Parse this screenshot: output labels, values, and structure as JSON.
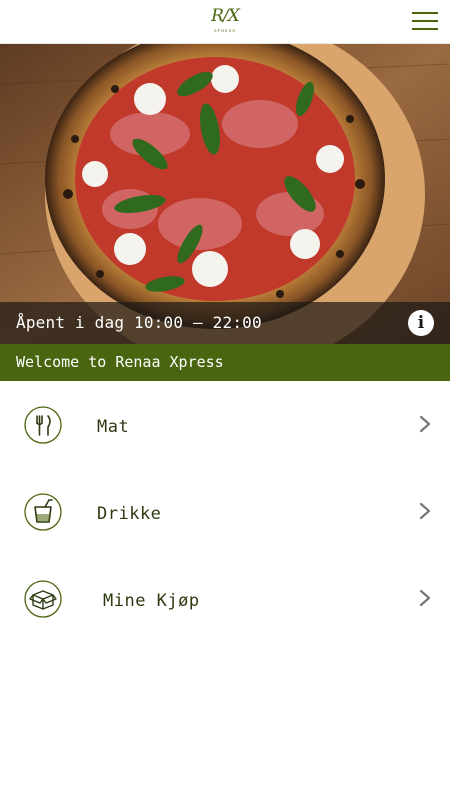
{
  "header": {
    "logo_mark": "R/X",
    "logo_subtitle": "XPRESS",
    "menu_icon": "hamburger-menu-icon"
  },
  "hero": {
    "image_icon": "pizza-photo",
    "opening_hours": "Åpent i dag 10:00 – 22:00",
    "info_icon": "info-icon",
    "info_glyph": "i"
  },
  "welcome": {
    "text": "Welcome to Renaa Xpress"
  },
  "menu": {
    "items": [
      {
        "label": "Mat",
        "icon": "fork-knife-icon"
      },
      {
        "label": "Drikke",
        "icon": "drink-glass-icon"
      },
      {
        "label": "Mine Kjøp",
        "icon": "box-icon"
      }
    ]
  },
  "colors": {
    "brand_green": "#4a6510",
    "text_dark": "#2d3a12"
  }
}
